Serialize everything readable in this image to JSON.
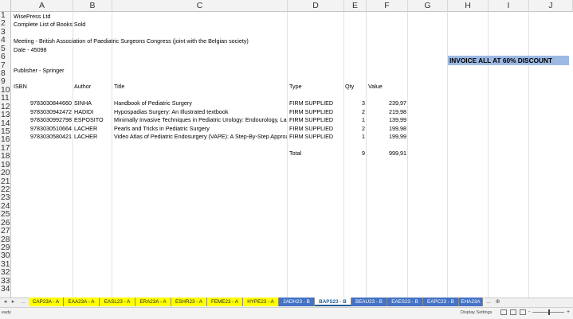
{
  "columns": [
    "A",
    "B",
    "C",
    "D",
    "E",
    "F",
    "G",
    "H",
    "I",
    "J"
  ],
  "rows": [
    "1",
    "2",
    "3",
    "4",
    "5",
    "6",
    "7",
    "8",
    "9",
    "10",
    "11",
    "12",
    "13",
    "14",
    "15",
    "16",
    "17",
    "18",
    "19",
    "20",
    "21",
    "22",
    "23",
    "24",
    "25",
    "26",
    "27",
    "28",
    "29",
    "30",
    "31",
    "32",
    "33",
    "34"
  ],
  "header": {
    "company": "WisePress Ltd",
    "list_title": "Complete List of Books Sold",
    "meeting": "Meeting - British Association of Paediatric Surgeons Congress (joint with the Belgian society)",
    "date": "Date - 45098",
    "publisher": "Publisher - Springer"
  },
  "banner": "INVOICE ALL AT 60% DISCOUNT",
  "table_headers": {
    "isbn": "ISBN",
    "author": "Author",
    "title": "Title",
    "type": "Type",
    "qty": "Qty",
    "value": "Value"
  },
  "books": [
    {
      "isbn": "9783030844660",
      "author": "SINHA",
      "title": "Handbook of Pediatric Surgery",
      "type": "FIRM SUPPLIED",
      "qty": "3",
      "value": "239,97"
    },
    {
      "isbn": "9783030942472",
      "author": "HADIDI",
      "title": "Hypospadias Surgery: An Illustrated textbook",
      "type": "FIRM SUPPLIED",
      "qty": "2",
      "value": "219,98"
    },
    {
      "isbn": "9783030992798",
      "author": "ESPOSITO",
      "title": "Minimally Invasive Techniques in Pediatric Urology: Endourology, Laparoscopy",
      "type": "FIRM SUPPLIED",
      "qty": "1",
      "value": "139,99"
    },
    {
      "isbn": "9783030510664",
      "author": "LACHER",
      "title": "Pearls and Tricks in Pediatric Surgery",
      "type": "FIRM SUPPLIED",
      "qty": "2",
      "value": "199,98"
    },
    {
      "isbn": "9783030580421",
      "author": "LACHER",
      "title": "Video Atlas of Pediatric Endosurgery (VAPE): A Step-By-Step Approach",
      "type": "FIRM SUPPLIED",
      "qty": "1",
      "value": "199,99"
    }
  ],
  "total": {
    "label": "Total",
    "qty": "9",
    "value": "999,91"
  },
  "tabs": [
    {
      "label": "CAP23A - A",
      "color": "yellow"
    },
    {
      "label": "EAA23A - A",
      "color": "yellow"
    },
    {
      "label": "EASL23 - A",
      "color": "yellow"
    },
    {
      "label": "ERA23A - A",
      "color": "yellow"
    },
    {
      "label": "ESHR23 - A",
      "color": "yellow"
    },
    {
      "label": "FEME23 - A",
      "color": "yellow"
    },
    {
      "label": "HYPE23 - A",
      "color": "yellow"
    },
    {
      "label": "2ADH23 - B",
      "color": "blue"
    },
    {
      "label": "BAPS23 - B",
      "color": "active"
    },
    {
      "label": "BEAU23 - B",
      "color": "blue"
    },
    {
      "label": "EAES23 - B",
      "color": "blue"
    },
    {
      "label": "EAPC23 - B",
      "color": "blue"
    },
    {
      "label": "EHA23A",
      "color": "blue"
    }
  ],
  "nav": {
    "prev": "◂",
    "next": "▸",
    "more": "..."
  },
  "status": {
    "ready": "eady",
    "display_settings": "Display Settings",
    "zoom_minus": "-",
    "zoom_plus": "+"
  }
}
